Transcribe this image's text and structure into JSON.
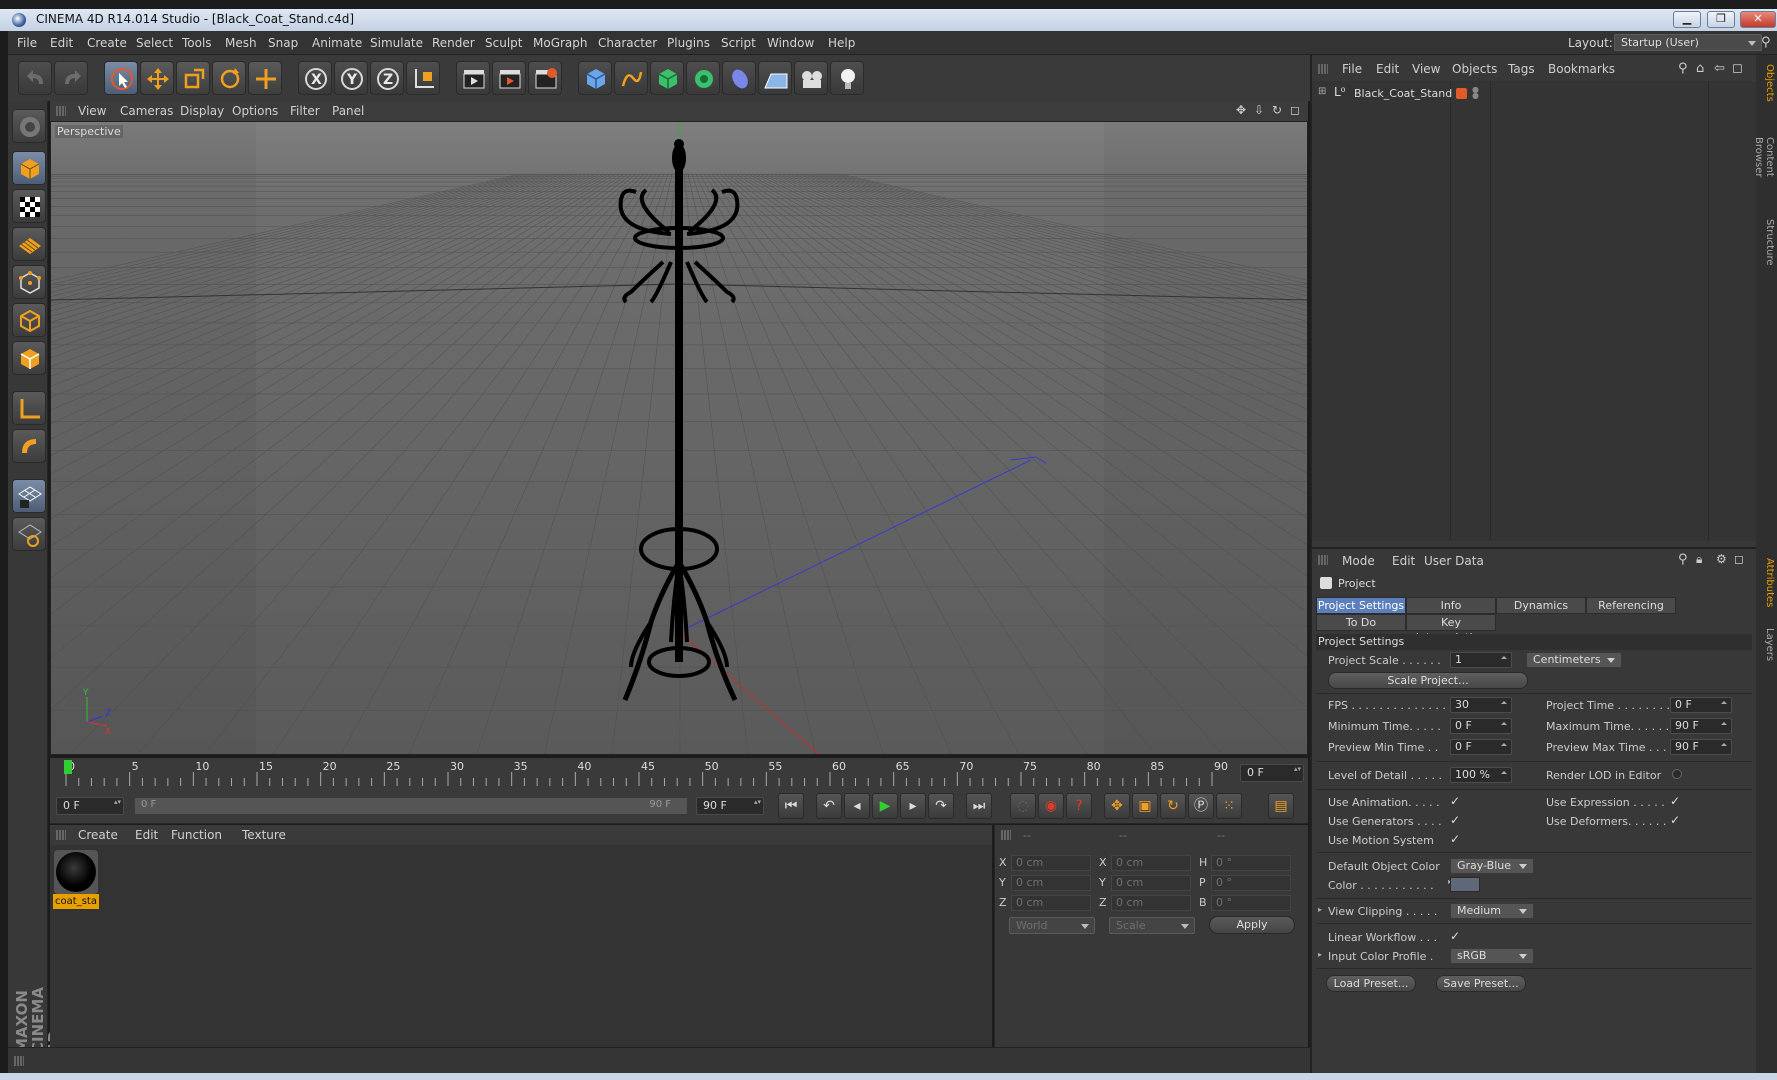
{
  "window": {
    "title": "CINEMA 4D R14.014 Studio - [Black_Coat_Stand.c4d]"
  },
  "menubar": {
    "items": [
      "File",
      "Edit",
      "Create",
      "Select",
      "Tools",
      "Mesh",
      "Snap",
      "Animate",
      "Simulate",
      "Render",
      "Sculpt",
      "MoGraph",
      "Character",
      "Plugins",
      "Script",
      "Window",
      "Help"
    ],
    "layout_label": "Layout:",
    "layout_value": "Startup (User)"
  },
  "viewport": {
    "menu": [
      "View",
      "Cameras",
      "Display",
      "Options",
      "Filter",
      "Panel"
    ],
    "label": "Perspective"
  },
  "timeline": {
    "ticks": [
      "0",
      "5",
      "10",
      "15",
      "20",
      "25",
      "30",
      "35",
      "40",
      "45",
      "50",
      "55",
      "60",
      "65",
      "70",
      "75",
      "80",
      "85",
      "90"
    ],
    "current_frame": "0 F"
  },
  "transport": {
    "start": "0 F",
    "range_start": "0 F",
    "range_end": "90 F",
    "end": "90 F"
  },
  "material_manager": {
    "menu": [
      "Create",
      "Edit",
      "Function",
      "Texture"
    ],
    "materials": [
      {
        "name": "coat_sta"
      }
    ]
  },
  "coordinates": {
    "headers": [
      "--",
      "--",
      "--"
    ],
    "rows": [
      {
        "l1": "X",
        "v1": "0 cm",
        "l2": "X",
        "v2": "0 cm",
        "l3": "H",
        "v3": "0 °"
      },
      {
        "l1": "Y",
        "v1": "0 cm",
        "l2": "Y",
        "v2": "0 cm",
        "l3": "P",
        "v3": "0 °"
      },
      {
        "l1": "Z",
        "v1": "0 cm",
        "l2": "Z",
        "v2": "0 cm",
        "l3": "B",
        "v3": "0 °"
      }
    ],
    "mode1": "World",
    "mode2": "Scale",
    "apply": "Apply"
  },
  "objects_panel": {
    "menu": [
      "File",
      "Edit",
      "View",
      "Objects",
      "Tags",
      "Bookmarks"
    ],
    "items": [
      {
        "name": "Black_Coat_Stand"
      }
    ]
  },
  "attributes": {
    "menu": [
      "Mode",
      "Edit",
      "User Data"
    ],
    "object": "Project",
    "tabs_row1": [
      "Project Settings",
      "Info",
      "Dynamics",
      "Referencing"
    ],
    "tabs_row2": [
      "To Do",
      "Key Interpolation"
    ],
    "section": "Project Settings",
    "project_scale_label": "Project Scale . . . . . .",
    "project_scale_value": "1",
    "project_scale_unit": "Centimeters",
    "scale_project_btn": "Scale Project...",
    "fps_label": "FPS . . . . . . . . . . . . . .",
    "fps_value": "30",
    "project_time_label": "Project Time . . . . . . . .",
    "project_time_value": "0 F",
    "min_time_label": "Minimum Time. . . . .",
    "min_time_value": "0 F",
    "max_time_label": "Maximum Time. . . . . .",
    "max_time_value": "90 F",
    "prev_min_label": "Preview Min Time . .",
    "prev_min_value": "0 F",
    "prev_max_label": "Preview Max Time . . .",
    "prev_max_value": "90 F",
    "lod_label": "Level of Detail . . . . .",
    "lod_value": "100 %",
    "render_lod_label": "Render LOD in Editor",
    "use_animation": "Use Animation. . . . .",
    "use_expression": "Use Expression . . . . .",
    "use_generators": "Use Generators . . . .",
    "use_deformers": "Use Deformers. . . . . .",
    "use_motion": "Use Motion System",
    "default_color_label": "Default Object Color",
    "default_color_value": "Gray-Blue",
    "color_label": "Color . . . . . . . . . . .",
    "view_clipping_label": "View Clipping . . . . .",
    "view_clipping_value": "Medium",
    "linear_workflow_label": "Linear Workflow . . .",
    "input_color_label": "Input Color Profile .",
    "input_color_value": "sRGB",
    "load_preset": "Load Preset...",
    "save_preset": "Save Preset..."
  },
  "side_tabs": [
    "Objects",
    "Content Browser",
    "Structure",
    "Attributes",
    "Layers"
  ],
  "colors": {
    "accent": "#5b7fbd",
    "material_tag": "#e8a000"
  }
}
